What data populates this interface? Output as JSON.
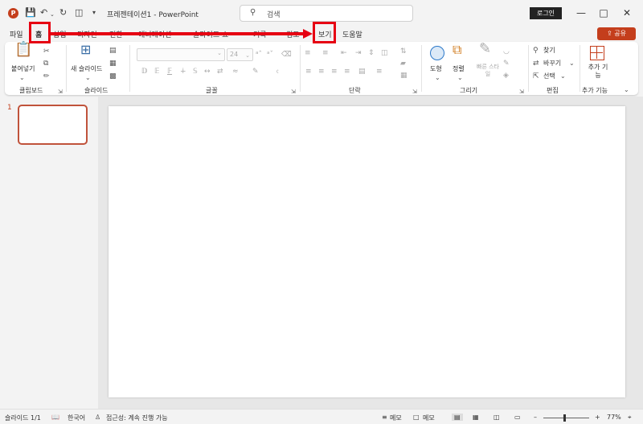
{
  "titlebar": {
    "logo_letter": "P",
    "save_icon": "save-icon",
    "undo_icon": "undo-icon",
    "redo_icon": "redo-icon",
    "doc_title": "프레젠테이션1  -  PowerPoint",
    "search_placeholder": "검색",
    "login_label": "로그인"
  },
  "tabs": [
    {
      "label": "파일"
    },
    {
      "label": "홈"
    },
    {
      "label": "삽입"
    },
    {
      "label": "디자인"
    },
    {
      "label": "전환"
    },
    {
      "label": "애니메이션"
    },
    {
      "label": "슬라이드 쇼"
    },
    {
      "label": "기록"
    },
    {
      "label": "검토"
    },
    {
      "label": "보기"
    },
    {
      "label": "도움말"
    }
  ],
  "share_label": "공유",
  "ribbon": {
    "clipboard": {
      "label": "클립보드",
      "paste_label": "붙여넣기"
    },
    "slides": {
      "label": "슬라이드",
      "new_slide_label": "새 슬라이드"
    },
    "font": {
      "label": "글꼴",
      "size_value": "24"
    },
    "paragraph": {
      "label": "단락"
    },
    "drawing": {
      "label": "그리기",
      "shape_label": "도형",
      "arrange_label": "정렬",
      "quick_styles_label": "빠른 스타일"
    },
    "editing": {
      "label": "편집",
      "find_label": "찾기",
      "replace_label": "바꾸기",
      "select_label": "선택"
    },
    "addins": {
      "label": "추가 기능",
      "addins_button_label": "추가 기능"
    }
  },
  "thumbnails": {
    "slide_number": "1"
  },
  "statusbar": {
    "slide_info": "슬라이드 1/1",
    "language": "한국어",
    "accessibility": "접근성: 계속 진행 가능",
    "notes_label": "메모",
    "comments_label": "메모",
    "zoom_percent": "77%",
    "zoom_level": 0.77
  },
  "annotations": {
    "highlight_color": "#e60012",
    "highlights": [
      "홈",
      "보기"
    ]
  },
  "colors": {
    "accent": "#c43e1c"
  }
}
